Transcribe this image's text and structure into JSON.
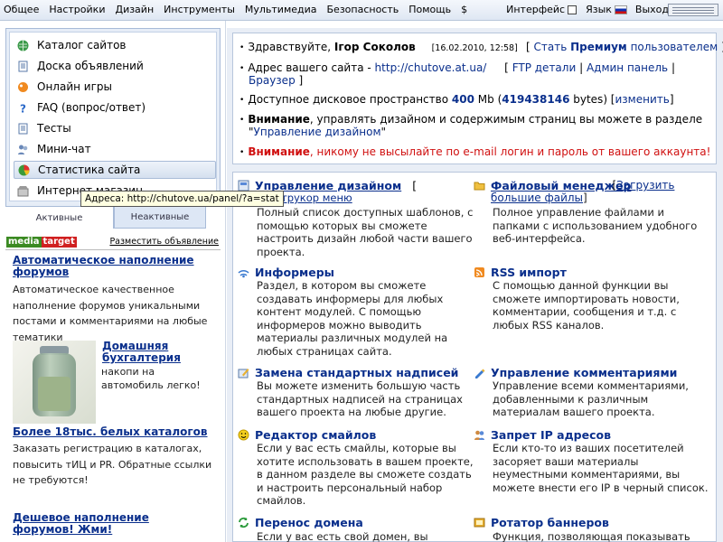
{
  "topmenu": {
    "items": [
      "Общее",
      "Настройки",
      "Дизайн",
      "Инструменты",
      "Мультимедиа",
      "Безопасность",
      "Помощь",
      "$"
    ],
    "interface_label": "Интерфейс",
    "language_label": "Язык",
    "logout_label": "Выход"
  },
  "sidebar": {
    "items": [
      {
        "label": "Каталог сайтов",
        "icon": "globe-icon"
      },
      {
        "label": "Доска объявлений",
        "icon": "document-icon"
      },
      {
        "label": "Онлайн игры",
        "icon": "game-icon"
      },
      {
        "label": "FAQ (вопрос/ответ)",
        "icon": "question-icon"
      },
      {
        "label": "Тесты",
        "icon": "document-icon"
      },
      {
        "label": "Мини-чат",
        "icon": "chat-icon"
      },
      {
        "label": "Статистика сайта",
        "icon": "pie-chart-icon"
      },
      {
        "label": "Интернет магазин",
        "icon": "shop-icon"
      }
    ],
    "selected_index": 6,
    "tooltip": "Адреса: http://chutove.ua/panel/?a=stat",
    "tabs": {
      "active": "Активные",
      "inactive": "Неактивные"
    }
  },
  "ads": {
    "logo_left": "media",
    "logo_right": "target",
    "place_ad_link": "Разместить объявление",
    "ad1_title": "Автоматическое наполнение форумов",
    "ad1_text": "Автоматическое качественное наполнение форумов уникальными постами и комментариями на любые тематики",
    "ad2_title": "Домашняя бухгалтерия",
    "ad2_text": "накопи на автомобиль легко!",
    "ad3_title": "Более 18тыс. белых каталогов",
    "ad3_text": "Заказать регистрацию в каталогах, повысить тИЦ и PR. Обратные ссылки не требуются!",
    "ad4_title": "Дешевое наполнение форумов! Жми!"
  },
  "info": {
    "greeting": "Здравствуйте,",
    "user_name": "Iгор Соколов",
    "date": "[16.02.2010, 12:58]",
    "premium_prefix": "Стать",
    "premium_word": "Премиум",
    "premium_suffix": "пользователем",
    "site_address_label": "Адрес вашего сайта -",
    "site_url": "http://chutove.at.ua/",
    "ftp_link": "FTP детали",
    "admin_link": "Админ панель",
    "browser_link": "Браузер",
    "disk_label": "Доступное дисковое пространство",
    "disk_mb": "400",
    "disk_unit": "Mb",
    "disk_bytes": "419438146",
    "disk_bytes_unit": "bytes",
    "change_link": "изменить",
    "attention_word": "Внимание",
    "attention1_text": ", управлять дизайном и содержимым страниц вы можете в разделе",
    "design_link": "Управление дизайном",
    "attention2_text": ", никому не высылайте по e-mail логин и пароль от вашего аккаунта!"
  },
  "features": [
    {
      "title": "Управление дизайном",
      "extra": "[",
      "text": "Полный список доступных шаблонов, с помощью которых вы сможете настроить дизайн любой части вашего проекта.",
      "icon": "design-icon",
      "sub": "трукор меню"
    },
    {
      "title": "Файловый менеджер",
      "link": "Загрузить большие файлы",
      "text": "Полное управление файлами и папками с использованием удобного веб-интерфейса.",
      "icon": "folder-icon"
    },
    {
      "title": "Информеры",
      "text": "Раздел, в котором вы сможете создавать информеры для любых контент модулей. С помощью информеров можно выводить материалы различных модулей на любых страницах сайта.",
      "icon": "signal-icon"
    },
    {
      "title": "RSS импорт",
      "text": "С помощью данной функции вы сможете импортировать новости, комментарии, сообщения и т.д. с любых RSS каналов.",
      "icon": "rss-icon"
    },
    {
      "title": "Замена стандартных надписей",
      "text": "Вы можете изменить большую часть стандартных надписей на страницах вашего проекта на любые другие.",
      "icon": "edit-icon"
    },
    {
      "title": "Управление комментариями",
      "text": "Управление всеми комментариями, добавленными к различным материалам вашего проекта.",
      "icon": "comment-icon"
    },
    {
      "title": "Редактор смайлов",
      "text": "Если у вас есть смайлы, которые вы хотите использовать в вашем проекте, в данном разделе вы сможете создать и настроить персональный набор смайлов.",
      "icon": "smile-icon"
    },
    {
      "title": "Запрет IP адресов",
      "text": "Если кто-то из ваших посетителей засоряет ваши материалы неуместными комментариями, вы можете внести его IP в черный список.",
      "icon": "users-icon"
    },
    {
      "title": "Перенос домена",
      "text": "Если у вас есть свой домен, вы можете",
      "icon": "refresh-icon"
    },
    {
      "title": "Ротатор баннеров",
      "text": "Функция, позволяющая показывать",
      "icon": "banner-icon"
    }
  ]
}
